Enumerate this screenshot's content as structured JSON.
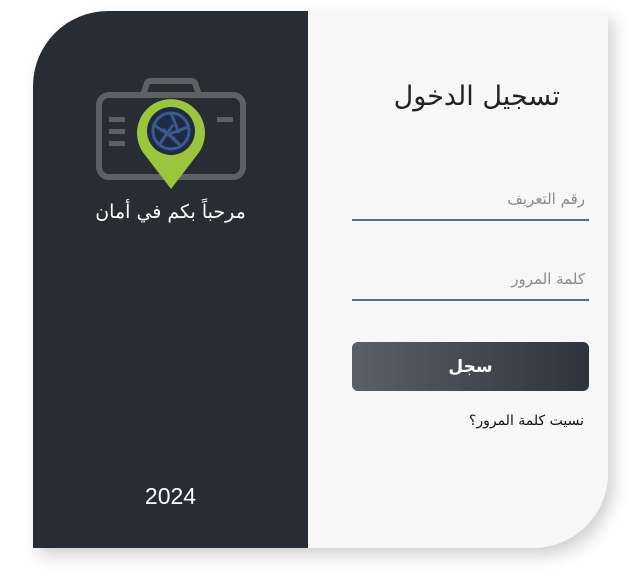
{
  "brand": {
    "welcome_text": "مرحباً بكم في أمان",
    "year": "2024",
    "logo_icon": "camera-location-pin-icon",
    "accent_color": "#9bc53d",
    "panel_color": "#282c34"
  },
  "login": {
    "title": "تسجيل الدخول",
    "id_placeholder": "رقم التعريف",
    "id_value": "",
    "password_placeholder": "كلمة المرور",
    "password_value": "",
    "submit_label": "سجل",
    "forgot_link": "نسيت كلمة المرور؟"
  }
}
